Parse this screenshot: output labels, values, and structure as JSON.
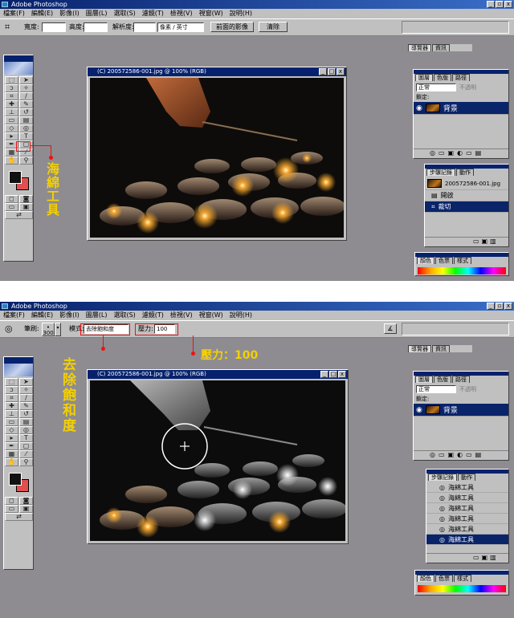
{
  "app_title": "Adobe Photoshop",
  "menu": [
    "檔案(F)",
    "編輯(E)",
    "影像(I)",
    "圖層(L)",
    "選取(S)",
    "濾鏡(T)",
    "檢視(V)",
    "視窗(W)",
    "說明(H)"
  ],
  "top": {
    "options": {
      "width_label": "寬度:",
      "height_label": "高度:",
      "resolution_label": "解析度:",
      "unit_select": "像素 / 英寸",
      "front_image_button": "前面的影像",
      "clear_button": "清除"
    },
    "annotation": "海綿工具"
  },
  "bottom": {
    "options": {
      "brush_label": "筆刷:",
      "brush_size": "300",
      "mode_label": "模式:",
      "mode_value": "去除飽和度",
      "pressure_label": "壓力:",
      "pressure_value": "100"
    },
    "annotation_mode": "去除飽和度",
    "annotation_pressure": "壓力：100"
  },
  "document_title": "(C) 200572586-001.jpg @ 100% (RGB)",
  "navigator_tabs": [
    "導覽器",
    "資訊"
  ],
  "layers": {
    "tabs": [
      "圖層",
      "色版",
      "路徑"
    ],
    "blend_mode": "正常",
    "opacity": "不透明",
    "lock_label": "鎖定:",
    "layer_name": "背景"
  },
  "history": {
    "tabs": [
      "步驟記錄",
      "動作"
    ],
    "snapshot": "200572586-001.jpg",
    "steps_top": [
      "開啟",
      "裁切"
    ],
    "steps_bottom": [
      "海綿工具",
      "海綿工具",
      "海綿工具",
      "海綿工具",
      "海綿工具",
      "海綿工具"
    ]
  },
  "color_tabs": [
    "顏色",
    "色票",
    "樣式"
  ],
  "colors": {
    "accent": "#e11111",
    "callout_text": "#f4d000",
    "titlebar": "#06226e"
  }
}
